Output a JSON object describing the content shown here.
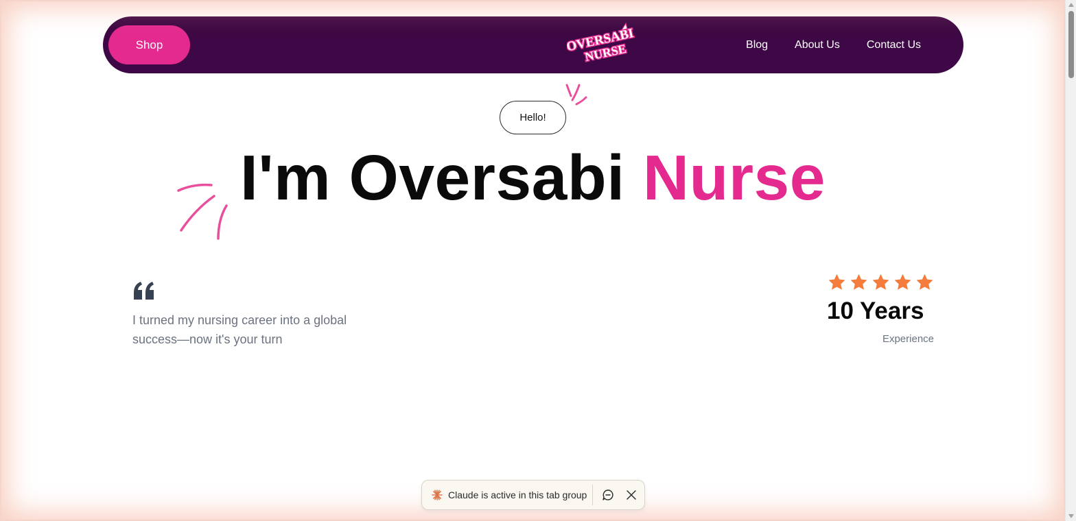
{
  "nav": {
    "shop_label": "Shop",
    "logo_line1": "OVERSABI",
    "logo_line2": "NURSE",
    "links": [
      {
        "label": "Blog"
      },
      {
        "label": "About Us"
      },
      {
        "label": "Contact Us"
      }
    ]
  },
  "hero": {
    "greeting": "Hello!",
    "headline_main": "I'm Oversabi ",
    "headline_accent": "Nurse"
  },
  "quote": {
    "text": "I turned my nursing career into a global success—now it's your turn"
  },
  "rating": {
    "stars": 5,
    "years": "10 Years",
    "label": "Experience"
  },
  "extension_bar": {
    "status_text": "Claude is active in this tab group"
  },
  "colors": {
    "brand_purple": "#3d0845",
    "brand_pink": "#e42a8f",
    "star_orange": "#f47c3c"
  },
  "icons": [
    "quote-icon",
    "star-icon",
    "claude-logo-icon",
    "chat-icon",
    "close-icon"
  ]
}
